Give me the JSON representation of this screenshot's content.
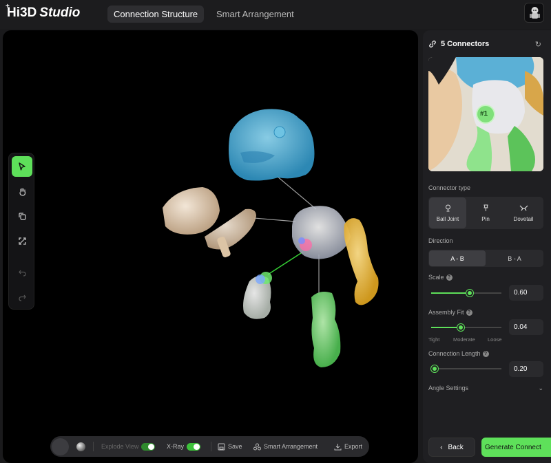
{
  "app": {
    "logo_main": "Hi3D",
    "logo_sub": "Studio",
    "logo_plus": "+"
  },
  "tabs": [
    {
      "label": "Connection Structure",
      "active": true
    },
    {
      "label": "Smart Arrangement",
      "active": false
    }
  ],
  "toolbar": {
    "tools": [
      {
        "icon": "select-cursor-icon",
        "active": true
      },
      {
        "icon": "hand-pan-icon"
      },
      {
        "icon": "rotate-icon"
      },
      {
        "icon": "fit-view-icon"
      },
      {
        "icon": "undo-icon",
        "disabled": true
      },
      {
        "icon": "redo-icon",
        "disabled": true
      }
    ]
  },
  "bottombar": {
    "explode_view_label": "Explode View",
    "explode_view_on": true,
    "xray_label": "X-Ray",
    "xray_on": true,
    "save_label": "Save",
    "smart_arrangement_label": "Smart Arrangement",
    "export_label": "Export"
  },
  "panel": {
    "title": "5 Connectors",
    "preview_badge": "#1",
    "connector_type_label": "Connector type",
    "connector_types": [
      {
        "label": "Ball Joint",
        "icon": "ball-joint-icon",
        "active": true
      },
      {
        "label": "Pin",
        "icon": "pin-icon",
        "active": false
      },
      {
        "label": "Dovetail",
        "icon": "dovetail-icon",
        "active": false
      }
    ],
    "direction_label": "Direction",
    "directions": [
      {
        "label": "A - B",
        "active": true
      },
      {
        "label": "B - A",
        "active": false
      }
    ],
    "scale_label": "Scale",
    "scale_value": "0.60",
    "scale_fraction": 0.55,
    "assembly_fit_label": "Assembly Fit",
    "assembly_fit_value": "0.04",
    "assembly_fit_fraction": 0.42,
    "fit_tight": "Tight",
    "fit_moderate": "Moderate",
    "fit_loose": "Loose",
    "connection_length_label": "Connection Length",
    "connection_length_value": "0.20",
    "connection_length_fraction": 0.05,
    "angle_settings_label": "Angle Settings",
    "back_label": "Back",
    "generate_label": "Generate Connect"
  },
  "colors": {
    "accent_green": "#5ee05a",
    "head_blue": "#4fb3d9",
    "arm_yellow": "#f0c040",
    "leg_green": "#7ed87a",
    "weapon_beige": "#e8d2b8"
  }
}
